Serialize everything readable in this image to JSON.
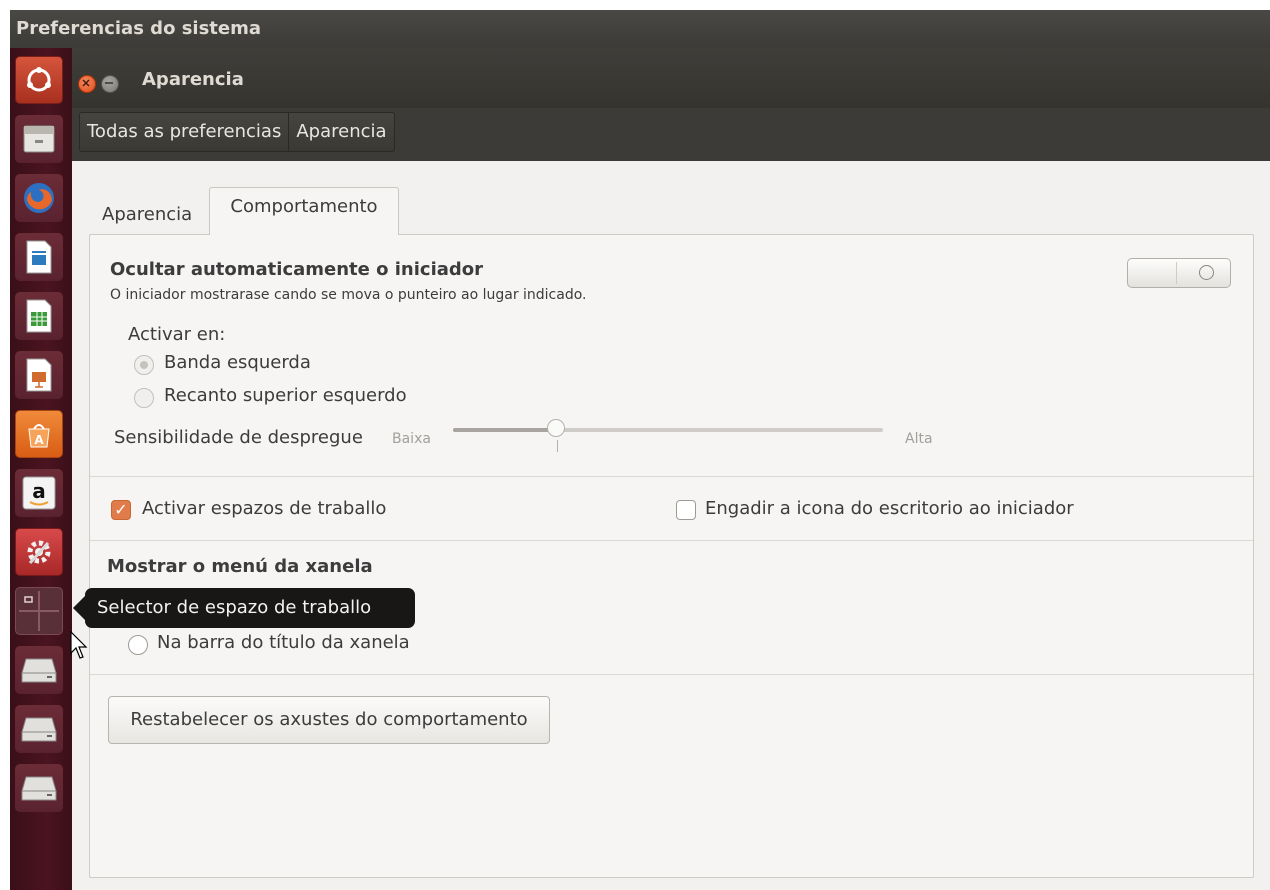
{
  "topbar": {
    "title": "Preferencias do sistema"
  },
  "launcher": {
    "items": [
      {
        "icon": "ubuntu-dash-icon",
        "color": "#c7472f"
      },
      {
        "icon": "files-cabinet-icon",
        "color": "#d6d3ce"
      },
      {
        "icon": "firefox-icon",
        "color": "#e8672a"
      },
      {
        "icon": "libreoffice-writer-icon",
        "color": "#2c7bbf"
      },
      {
        "icon": "libreoffice-calc-icon",
        "color": "#3a9a3a"
      },
      {
        "icon": "libreoffice-impress-icon",
        "color": "#cf6b2e"
      },
      {
        "icon": "software-center-icon",
        "color": "#e76e1e"
      },
      {
        "icon": "amazon-icon",
        "color": "#f0f0f0",
        "glyph": "a"
      },
      {
        "icon": "system-settings-icon",
        "color": "#c83a3a"
      },
      {
        "icon": "workspace-switcher-icon",
        "color": "#5a3038"
      },
      {
        "icon": "drive-icon",
        "color": "#cfcdc9"
      },
      {
        "icon": "drive-icon",
        "color": "#cfcdc9"
      },
      {
        "icon": "drive-icon",
        "color": "#cfcdc9"
      }
    ]
  },
  "window": {
    "title": "Aparencia",
    "close_color": "#e95420",
    "minimize_color": "#8c8a85"
  },
  "toolbar": {
    "crumbs": [
      "Todas as preferencias",
      "Aparencia"
    ]
  },
  "tabs": {
    "inactive": "Aparencia",
    "active": "Comportamento"
  },
  "autohide": {
    "title": "Ocultar automaticamente o iniciador",
    "description": "O iniciador mostrarase cando se mova o punteiro ao lugar indicado.",
    "enabled": false,
    "activate_label": "Activar en:",
    "options": [
      "Banda esquerda",
      "Recanto superior esquerdo"
    ],
    "selected_option": "Banda esquerda",
    "sensitivity_label": "Sensibilidade de despregue",
    "slider_min_label": "Baixa",
    "slider_max_label": "Alta",
    "sensitivity_value": 0.24
  },
  "workspaces": {
    "enable_label": "Activar espazos de traballo",
    "enable_checked": true,
    "desktop_icon_label": "Engadir a icona do escritorio ao iniciador",
    "desktop_icon_checked": false
  },
  "window_menu": {
    "title": "Mostrar o menú da xanela",
    "option_title_bar": "Na barra do título da xanela"
  },
  "reset_button": "Restabelecer os axustes do comportamento",
  "tooltip": "Selector de espazo de traballo",
  "accent": "#e07b4a"
}
